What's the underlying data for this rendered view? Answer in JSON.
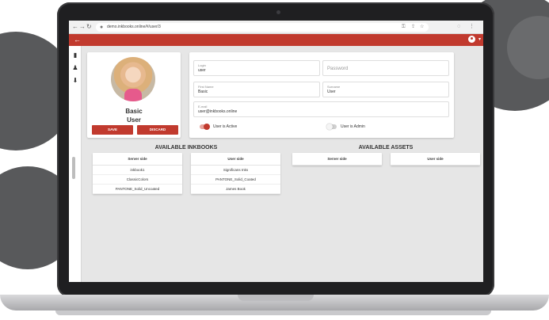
{
  "browser": {
    "back_icon": "arrow-left-icon",
    "forward_icon": "arrow-right-icon",
    "reload_icon": "reload-icon",
    "url": "demo.inkbooks.online/#/user/3"
  },
  "appbar": {
    "color": "#c13a2e",
    "back_icon": "arrow-left-icon",
    "user_icon": "account-circle-icon"
  },
  "rail": {
    "icons": [
      "book-icon",
      "users-icon",
      "download-icon"
    ]
  },
  "profile": {
    "first_name": "Basic",
    "last_name": "User",
    "save_label": "SAVE",
    "discard_label": "DISCARD"
  },
  "form": {
    "login": {
      "label": "Login",
      "value": "user"
    },
    "password": {
      "placeholder": "Password"
    },
    "first_name": {
      "label": "First Name",
      "value": "Basic"
    },
    "surname": {
      "label": "Surname",
      "value": "User"
    },
    "email": {
      "label": "E-mail",
      "value": "user@inkbooks.online"
    },
    "active": {
      "label": "User is Active",
      "on": true
    },
    "admin": {
      "label": "User is Admin",
      "on": false
    }
  },
  "inkbooks": {
    "title": "AVAILABLE INKBOOKS",
    "server": {
      "header": "Server side",
      "items": [
        "inkbook1",
        "ClassicColors",
        "PANTONE_Solid_Uncoated"
      ]
    },
    "user": {
      "header": "User side",
      "items": [
        "Significans Inks",
        "PANTONE_Solid_Coated",
        "James Book"
      ]
    }
  },
  "assets": {
    "title": "AVAILABLE ASSETS",
    "server": {
      "header": "Server side"
    },
    "user": {
      "header": "User side"
    }
  }
}
